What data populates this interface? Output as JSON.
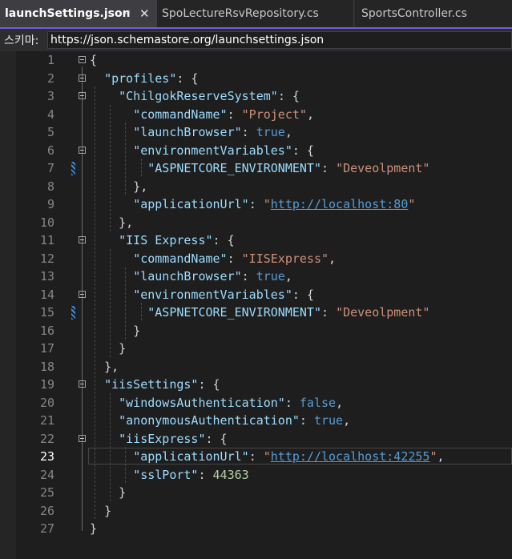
{
  "tabs": [
    {
      "label": "launchSettings.json",
      "active": true
    },
    {
      "label": "SpoLectureRsvRepository.cs",
      "active": false
    },
    {
      "label": "SportsController.cs",
      "active": false
    }
  ],
  "tab_pin_glyph": "⊣",
  "tab_close_glyph": "✕",
  "schema": {
    "label": "스키마:",
    "value": "https://json.schemastore.org/launchsettings.json"
  },
  "editor": {
    "current_line": 23,
    "lines": [
      {
        "n": "1"
      },
      {
        "n": "2"
      },
      {
        "n": "3"
      },
      {
        "n": "4"
      },
      {
        "n": "5"
      },
      {
        "n": "6"
      },
      {
        "n": "7"
      },
      {
        "n": "8"
      },
      {
        "n": "9"
      },
      {
        "n": "10"
      },
      {
        "n": "11"
      },
      {
        "n": "12"
      },
      {
        "n": "13"
      },
      {
        "n": "14"
      },
      {
        "n": "15"
      },
      {
        "n": "16"
      },
      {
        "n": "17"
      },
      {
        "n": "18"
      },
      {
        "n": "19"
      },
      {
        "n": "20"
      },
      {
        "n": "21"
      },
      {
        "n": "22"
      },
      {
        "n": "23"
      },
      {
        "n": "24"
      },
      {
        "n": "25"
      },
      {
        "n": "26"
      },
      {
        "n": "27"
      }
    ],
    "text": {
      "l1_brace": "{",
      "l2_key": "\"profiles\"",
      "l3_key": "\"ChilgokReserveSystem\"",
      "l4_key": "\"commandName\"",
      "l4_val": "\"Project\"",
      "l5_key": "\"launchBrowser\"",
      "l5_val": "true",
      "l6_key": "\"environmentVariables\"",
      "l7_key": "\"ASPNETCORE_ENVIRONMENT\"",
      "l7_val": "\"Deveolpment\"",
      "l8": "},",
      "l9_key": "\"applicationUrl\"",
      "l9_q1": "\"",
      "l9_url": "http://localhost:80",
      "l9_q2": "\"",
      "l10": "},",
      "l11_key": "\"IIS Express\"",
      "l12_key": "\"commandName\"",
      "l12_val": "\"IISExpress\"",
      "l13_key": "\"launchBrowser\"",
      "l13_val": "true",
      "l14_key": "\"environmentVariables\"",
      "l15_key": "\"ASPNETCORE_ENVIRONMENT\"",
      "l15_val": "\"Deveolpment\"",
      "l16": "}",
      "l17": "}",
      "l18": "},",
      "l19_key": "\"iisSettings\"",
      "l20_key": "\"windowsAuthentication\"",
      "l20_val": "false",
      "l21_key": "\"anonymousAuthentication\"",
      "l21_val": "true",
      "l22_key": "\"iisExpress\"",
      "l23_key": "\"applicationUrl\"",
      "l23_q1": "\"",
      "l23_url": "http://localhost:42255",
      "l23_q2": "\"",
      "l24_key": "\"sslPort\"",
      "l24_val": "44363",
      "l25": "}",
      "l26": "}",
      "l27": "}"
    }
  }
}
